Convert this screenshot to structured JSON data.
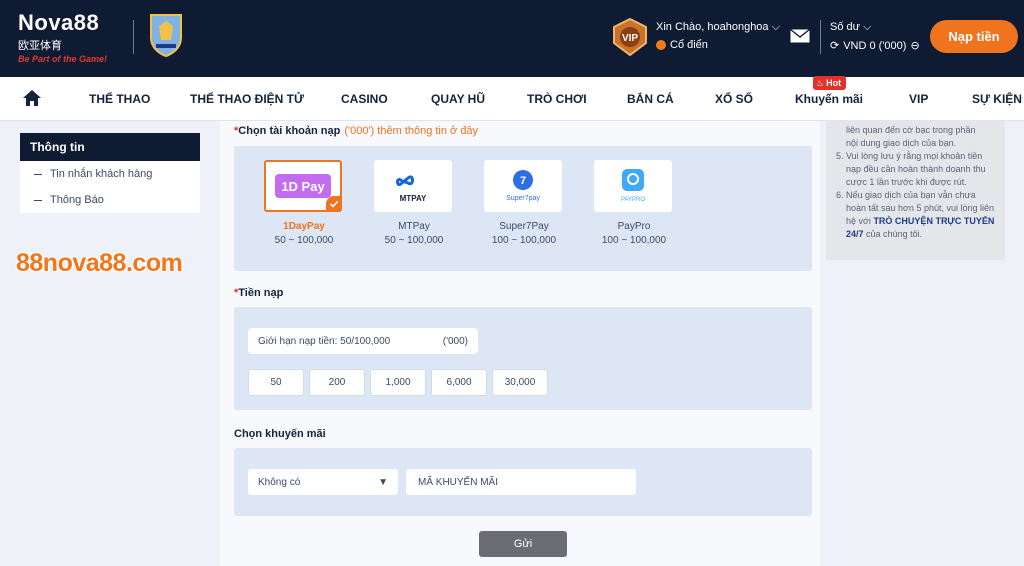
{
  "header": {
    "brand": "Nova88",
    "brand_cn": "欧亚体育",
    "slogan": "Be Part of the Game!",
    "greeting": "Xin Chào, hoahonghoa",
    "vip_level": "Cổ điển",
    "balance_label": "Số dư",
    "balance_value": "VND 0 ('000)",
    "deposit_button": "Nạp tiền",
    "vip_badge_text": "VIP"
  },
  "nav": {
    "items": [
      "THỂ THAO",
      "THỂ THAO ĐIỆN TỬ",
      "CASINO",
      "QUAY HŨ",
      "TRÒ CHƠI",
      "BẮN CÁ",
      "XỔ SỐ",
      "Khuyến mãi",
      "VIP",
      "SỰ KIỆN"
    ],
    "hot_badge": "Hot"
  },
  "sidebar": {
    "title": "Thông tin",
    "items": [
      "Tin nhắn khách hàng",
      "Thông Báo"
    ]
  },
  "watermark": "88nova88.com",
  "account_section": {
    "label": "Chọn tài khoản nạp",
    "hint": "('000') thêm thông tin ở đây",
    "methods": [
      {
        "name": "1DayPay",
        "range": "50 ~ 100,000",
        "logo": "1D Pay"
      },
      {
        "name": "MTPay",
        "range": "50 ~ 100,000",
        "logo": "MTPAY"
      },
      {
        "name": "Super7Pay",
        "range": "100 ~ 100,000",
        "logo": "Super7pay"
      },
      {
        "name": "PayPro",
        "range": "100 ~ 100,000",
        "logo": "PAYPRO"
      }
    ]
  },
  "amount_section": {
    "label": "Tiền nạp",
    "input_text": "Giới hạn nạp tiền: 50/100,000",
    "input_unit": "('000)",
    "chips": [
      "50",
      "200",
      "1,000",
      "6,000",
      "30,000"
    ]
  },
  "promo_section": {
    "label": "Chọn khuyến mãi",
    "select_value": "Không có",
    "code_placeholder": "MÃ KHUYẾN MÃI",
    "submit": "Gửi"
  },
  "notes": {
    "line_a": "liên quan đến cờ bạc trong phần",
    "line_b": "nội dung giao dịch của bạn.",
    "n5_num": "5.",
    "n5": "Vui lòng lưu ý rằng mọi khoản tiền nạp đều cần hoàn thành doanh thu cược 1 lần trước khi được rút.",
    "n6_num": "6.",
    "n6_pre": "Nếu giao dịch của bạn vẫn chưa hoàn tất sau hơn 5 phút, vui lòng liên hệ với",
    "n6_link": "TRÒ CHUYỆN TRỰC TUYẾN 24/7",
    "n6_post": "của chúng tôi."
  }
}
